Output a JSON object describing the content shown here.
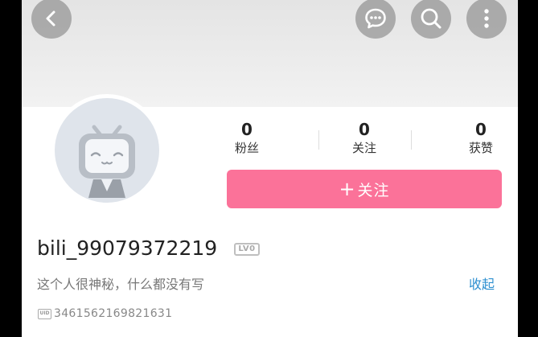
{
  "header": {
    "back_icon": "chevron-left-icon",
    "actions": [
      "message-icon",
      "search-icon",
      "more-vertical-icon"
    ]
  },
  "stats": [
    {
      "value": "0",
      "label": "粉丝"
    },
    {
      "value": "0",
      "label": "关注"
    },
    {
      "value": "0",
      "label": "获赞"
    }
  ],
  "follow_button": {
    "icon": "+",
    "label": "关注",
    "color": "#fb7299"
  },
  "profile": {
    "username": "bili_99079372219",
    "level": "LV0",
    "bio": "这个人很神秘，什么都没有写",
    "collapse_label": "收起",
    "uid": "3461562169821631"
  },
  "colors": {
    "accent": "#fb7299",
    "link": "#2d8fd0"
  }
}
